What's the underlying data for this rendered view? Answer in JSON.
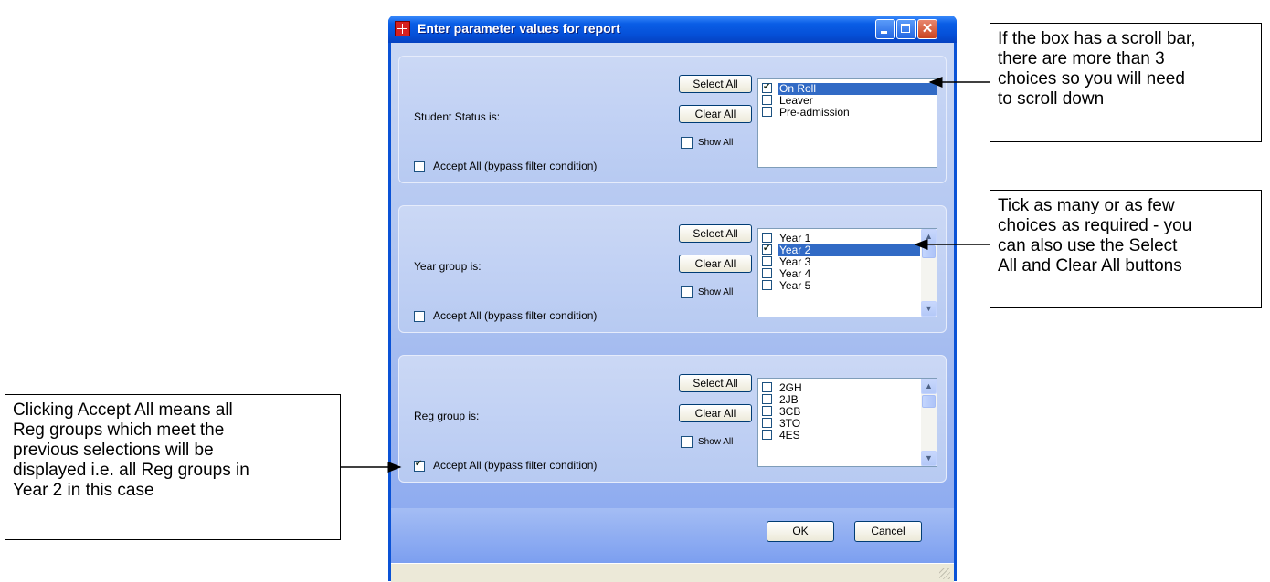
{
  "window": {
    "title": "Enter parameter values for report",
    "ok_label": "OK",
    "cancel_label": "Cancel"
  },
  "panels": [
    {
      "label": "Student Status is:",
      "select_all": "Select All",
      "clear_all": "Clear All",
      "show_all": "Show All",
      "show_all_checked": false,
      "accept_all": "Accept All (bypass filter condition)",
      "accept_all_checked": false,
      "has_scrollbar": false,
      "items": [
        {
          "label": "On Roll",
          "checked": true,
          "selected": true
        },
        {
          "label": "Leaver",
          "checked": false,
          "selected": false
        },
        {
          "label": "Pre-admission",
          "checked": false,
          "selected": false
        }
      ]
    },
    {
      "label": "Year group is:",
      "select_all": "Select All",
      "clear_all": "Clear All",
      "show_all": "Show All",
      "show_all_checked": false,
      "accept_all": "Accept All (bypass filter condition)",
      "accept_all_checked": false,
      "has_scrollbar": true,
      "items": [
        {
          "label": "Year 1",
          "checked": false,
          "selected": false
        },
        {
          "label": "Year 2",
          "checked": true,
          "selected": true
        },
        {
          "label": "Year 3",
          "checked": false,
          "selected": false
        },
        {
          "label": "Year 4",
          "checked": false,
          "selected": false
        },
        {
          "label": "Year 5",
          "checked": false,
          "selected": false
        }
      ]
    },
    {
      "label": "Reg group is:",
      "select_all": "Select All",
      "clear_all": "Clear All",
      "show_all": "Show All",
      "show_all_checked": false,
      "accept_all": "Accept All (bypass filter condition)",
      "accept_all_checked": true,
      "has_scrollbar": true,
      "items": [
        {
          "label": "2GH",
          "checked": false,
          "selected": false
        },
        {
          "label": "2JB",
          "checked": false,
          "selected": false
        },
        {
          "label": "3CB",
          "checked": false,
          "selected": false
        },
        {
          "label": "3TO",
          "checked": false,
          "selected": false
        },
        {
          "label": "4ES",
          "checked": false,
          "selected": false
        }
      ]
    }
  ],
  "callouts": {
    "scroll": [
      "If the box has a scroll bar,",
      "there are more than 3",
      "choices so you will need",
      "to scroll down"
    ],
    "tick": [
      "Tick as many or as few",
      "choices as required - you",
      "can also use the Select",
      "All and Clear All buttons"
    ],
    "accept": [
      "Clicking Accept All means all",
      "Reg groups which meet the",
      "previous selections will be",
      "displayed i.e. all Reg groups in",
      "Year 2 in this case"
    ]
  }
}
